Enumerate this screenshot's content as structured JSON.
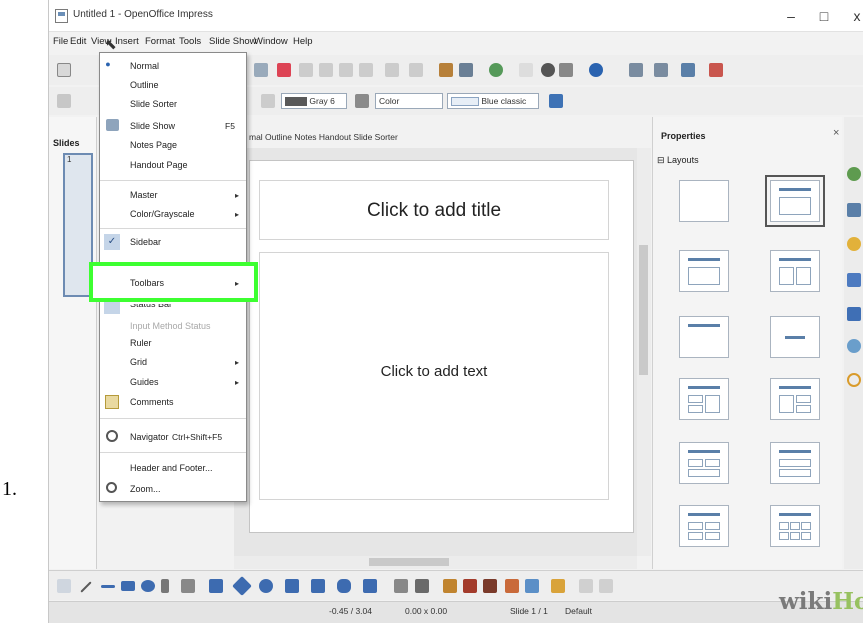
{
  "step_number": "1.",
  "window": {
    "title": "Untitled 1 - OpenOffice Impress",
    "controls": [
      "–",
      "□",
      "x"
    ]
  },
  "menubar": [
    "File",
    "Edit",
    "View",
    "Insert",
    "Format",
    "Tools",
    "Slide Show",
    "Window",
    "Help"
  ],
  "toolbar2": {
    "color_select": "Gray 6",
    "mode_select": "Color",
    "style_select": "Blue classic"
  },
  "slides_panel": {
    "title": "Slides",
    "slide_number": "1"
  },
  "view_tabs": "mal   Outline   Notes   Handout   Slide Sorter",
  "slide": {
    "title_placeholder": "Click to add title",
    "text_placeholder": "Click to add text"
  },
  "properties": {
    "title": "Properties",
    "close": "×",
    "section": "⊟ Layouts"
  },
  "view_menu": {
    "items": [
      {
        "label": "Normal",
        "checked": true
      },
      {
        "label": "Outline"
      },
      {
        "label": "Slide Sorter"
      },
      {
        "label": "Slide Show",
        "shortcut": "F5"
      },
      {
        "label": "Notes Page"
      },
      {
        "label": "Handout Page"
      },
      {
        "label": "Master",
        "submenu": true
      },
      {
        "label": "Color/Grayscale",
        "submenu": true
      },
      {
        "label": "Sidebar",
        "checked": true
      },
      {
        "label": "Toolbars",
        "submenu": true,
        "highlighted": true
      },
      {
        "label": "Status Bar"
      },
      {
        "label": "Input Method Status",
        "disabled": true
      },
      {
        "label": "Ruler"
      },
      {
        "label": "Grid",
        "submenu": true
      },
      {
        "label": "Guides",
        "submenu": true
      },
      {
        "label": "Comments"
      },
      {
        "label": "Navigator",
        "shortcut": "Ctrl+Shift+F5"
      },
      {
        "label": "Header and Footer..."
      },
      {
        "label": "Zoom..."
      }
    ]
  },
  "statusbar": {
    "position": "-0.45 / 3.04",
    "size": "0.00 x 0.00",
    "slide": "Slide 1 / 1",
    "layout": "Default"
  },
  "watermark": {
    "wiki": "wiki",
    "how": "How"
  },
  "colors": {
    "highlight": "#3dff31",
    "accent": "#5a7fa8"
  }
}
